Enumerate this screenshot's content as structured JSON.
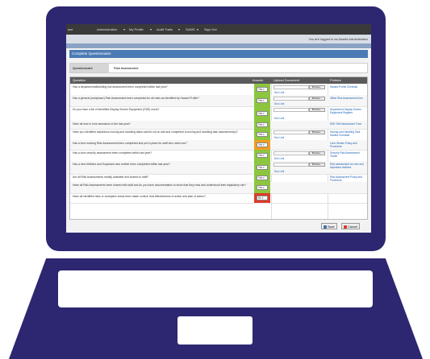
{
  "nav": {
    "items": [
      "ave",
      "Administration",
      "My Profile",
      "Audit Trails",
      "SUMS",
      "Sign Out"
    ]
  },
  "subbar": {
    "logged_in": "You are logged in as Assets Administrator"
  },
  "panel": {
    "title": "Complete Questionnaire"
  },
  "questionnaire": {
    "label": "Questionnaire",
    "value": "Risk Assessment"
  },
  "table": {
    "headers": {
      "question": "Question",
      "answer": "Answer",
      "upload": "Upload Document",
      "policies": "Policies"
    },
    "browse_label": "Browse...",
    "upload_link_label": "Doc Link",
    "rows": [
      {
        "question": "Has a departmental/building risk assessment been completed within last year?",
        "answer": "Yes",
        "status": "green",
        "has_upload": true,
        "policy": "Hazard Profile Checklist"
      },
      {
        "question": "Has a general (workplace) Risk Assessment been completed for all roles as identified by Hazard Profile?",
        "answer": "Yes",
        "status": "green",
        "has_upload": true,
        "policy": "Office Risk Assessment form"
      },
      {
        "question": "Do you have a list of identified Display Screen Equipment (DSE) users?",
        "answer": "Yes",
        "status": "green",
        "has_upload": true,
        "policy": "Department Display Screen Equipment Register"
      },
      {
        "question": "Have all new or lone assessors in the last year?",
        "answer": "Yes",
        "status": "green",
        "has_upload": false,
        "policy": "DSE Self Assessment Form"
      },
      {
        "question": "Have you identified hazardous moving and handling tasks carried out on site and completed a moving and handling task assessment(s)?",
        "answer": "Yes",
        "status": "green",
        "has_upload": true,
        "policy": "Moving and Handling Task Hazard Checklist"
      },
      {
        "question": "Has a lone working Risk Assessment been completed and put in place for staff who need one?",
        "answer": "Yes",
        "status": "orange",
        "has_upload": false,
        "policy": "Lone Worker Policy and Procedure"
      },
      {
        "question": "Has a lone security assessment been completed within last year?",
        "answer": "Yes",
        "status": "green",
        "has_upload": true,
        "policy": "Security Risk Assessment Toolkit"
      },
      {
        "question": "Has a new Mothers and Expectant new mother been completed within last year?",
        "answer": "Yes",
        "status": "green",
        "has_upload": true,
        "policy": "Risk assessment for new and expectant mothers"
      },
      {
        "question": "Are all Risk Assessments readily available and shared to staff?",
        "answer": "Yes",
        "status": "green",
        "has_upload": false,
        "policy": "Risk Assessment Policy and Procedure"
      },
      {
        "question": "Have all Risk Assessments been shared with staff and do you have documentation to show that they read and understood their legislatory role?",
        "answer": "Yes",
        "status": "green",
        "has_upload": false,
        "policy": ""
      },
      {
        "question": "Have all identified risks or workplace areas been made control, that effectiveness of action and plan of action?",
        "answer": "No",
        "status": "red",
        "has_upload": false,
        "policy": ""
      }
    ]
  },
  "footer": {
    "save_label": "Save",
    "cancel_label": "Cancel"
  },
  "colors": {
    "laptop": "#2d2771",
    "answer_ok": "#8cc63e",
    "answer_warn": "#f39c1f",
    "answer_bad": "#e03a2a",
    "panel_header": "#4b7bb5"
  }
}
